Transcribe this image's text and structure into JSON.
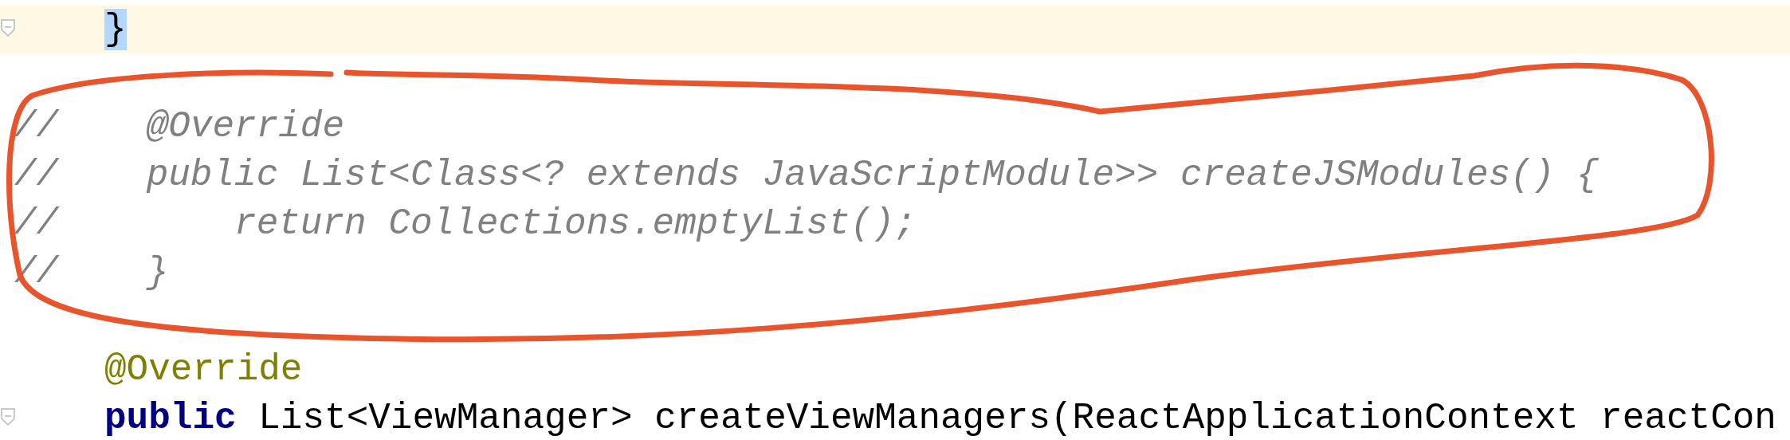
{
  "editor": {
    "lines": [
      {
        "kind": "code",
        "caret": true,
        "fold": true,
        "indented": true,
        "segments": [
          {
            "kind": "brace-match",
            "text": "}"
          }
        ]
      },
      {
        "kind": "blank",
        "caret": false,
        "fold": false
      },
      {
        "kind": "comment",
        "caret": false,
        "fold": false,
        "segments": [
          {
            "kind": "comment",
            "text": "//    @Override"
          }
        ]
      },
      {
        "kind": "comment",
        "caret": false,
        "fold": false,
        "segments": [
          {
            "kind": "comment",
            "text": "//    public List<Class<? extends JavaScriptModule>> createJSModules() {"
          }
        ]
      },
      {
        "kind": "comment",
        "caret": false,
        "fold": false,
        "segments": [
          {
            "kind": "comment",
            "text": "//        return Collections.emptyList();"
          }
        ]
      },
      {
        "kind": "comment",
        "caret": false,
        "fold": false,
        "segments": [
          {
            "kind": "comment",
            "text": "//    }"
          }
        ]
      },
      {
        "kind": "blank",
        "caret": false,
        "fold": false
      },
      {
        "kind": "code",
        "caret": false,
        "fold": false,
        "indented": true,
        "segments": [
          {
            "kind": "annotation",
            "text": "@Override"
          }
        ]
      },
      {
        "kind": "code",
        "caret": false,
        "fold": true,
        "indented": true,
        "segments": [
          {
            "kind": "keyword",
            "text": "public"
          },
          {
            "kind": "plain",
            "text": " List<ViewManager> createViewManagers(ReactApplicationContext reactCon"
          }
        ]
      }
    ]
  }
}
